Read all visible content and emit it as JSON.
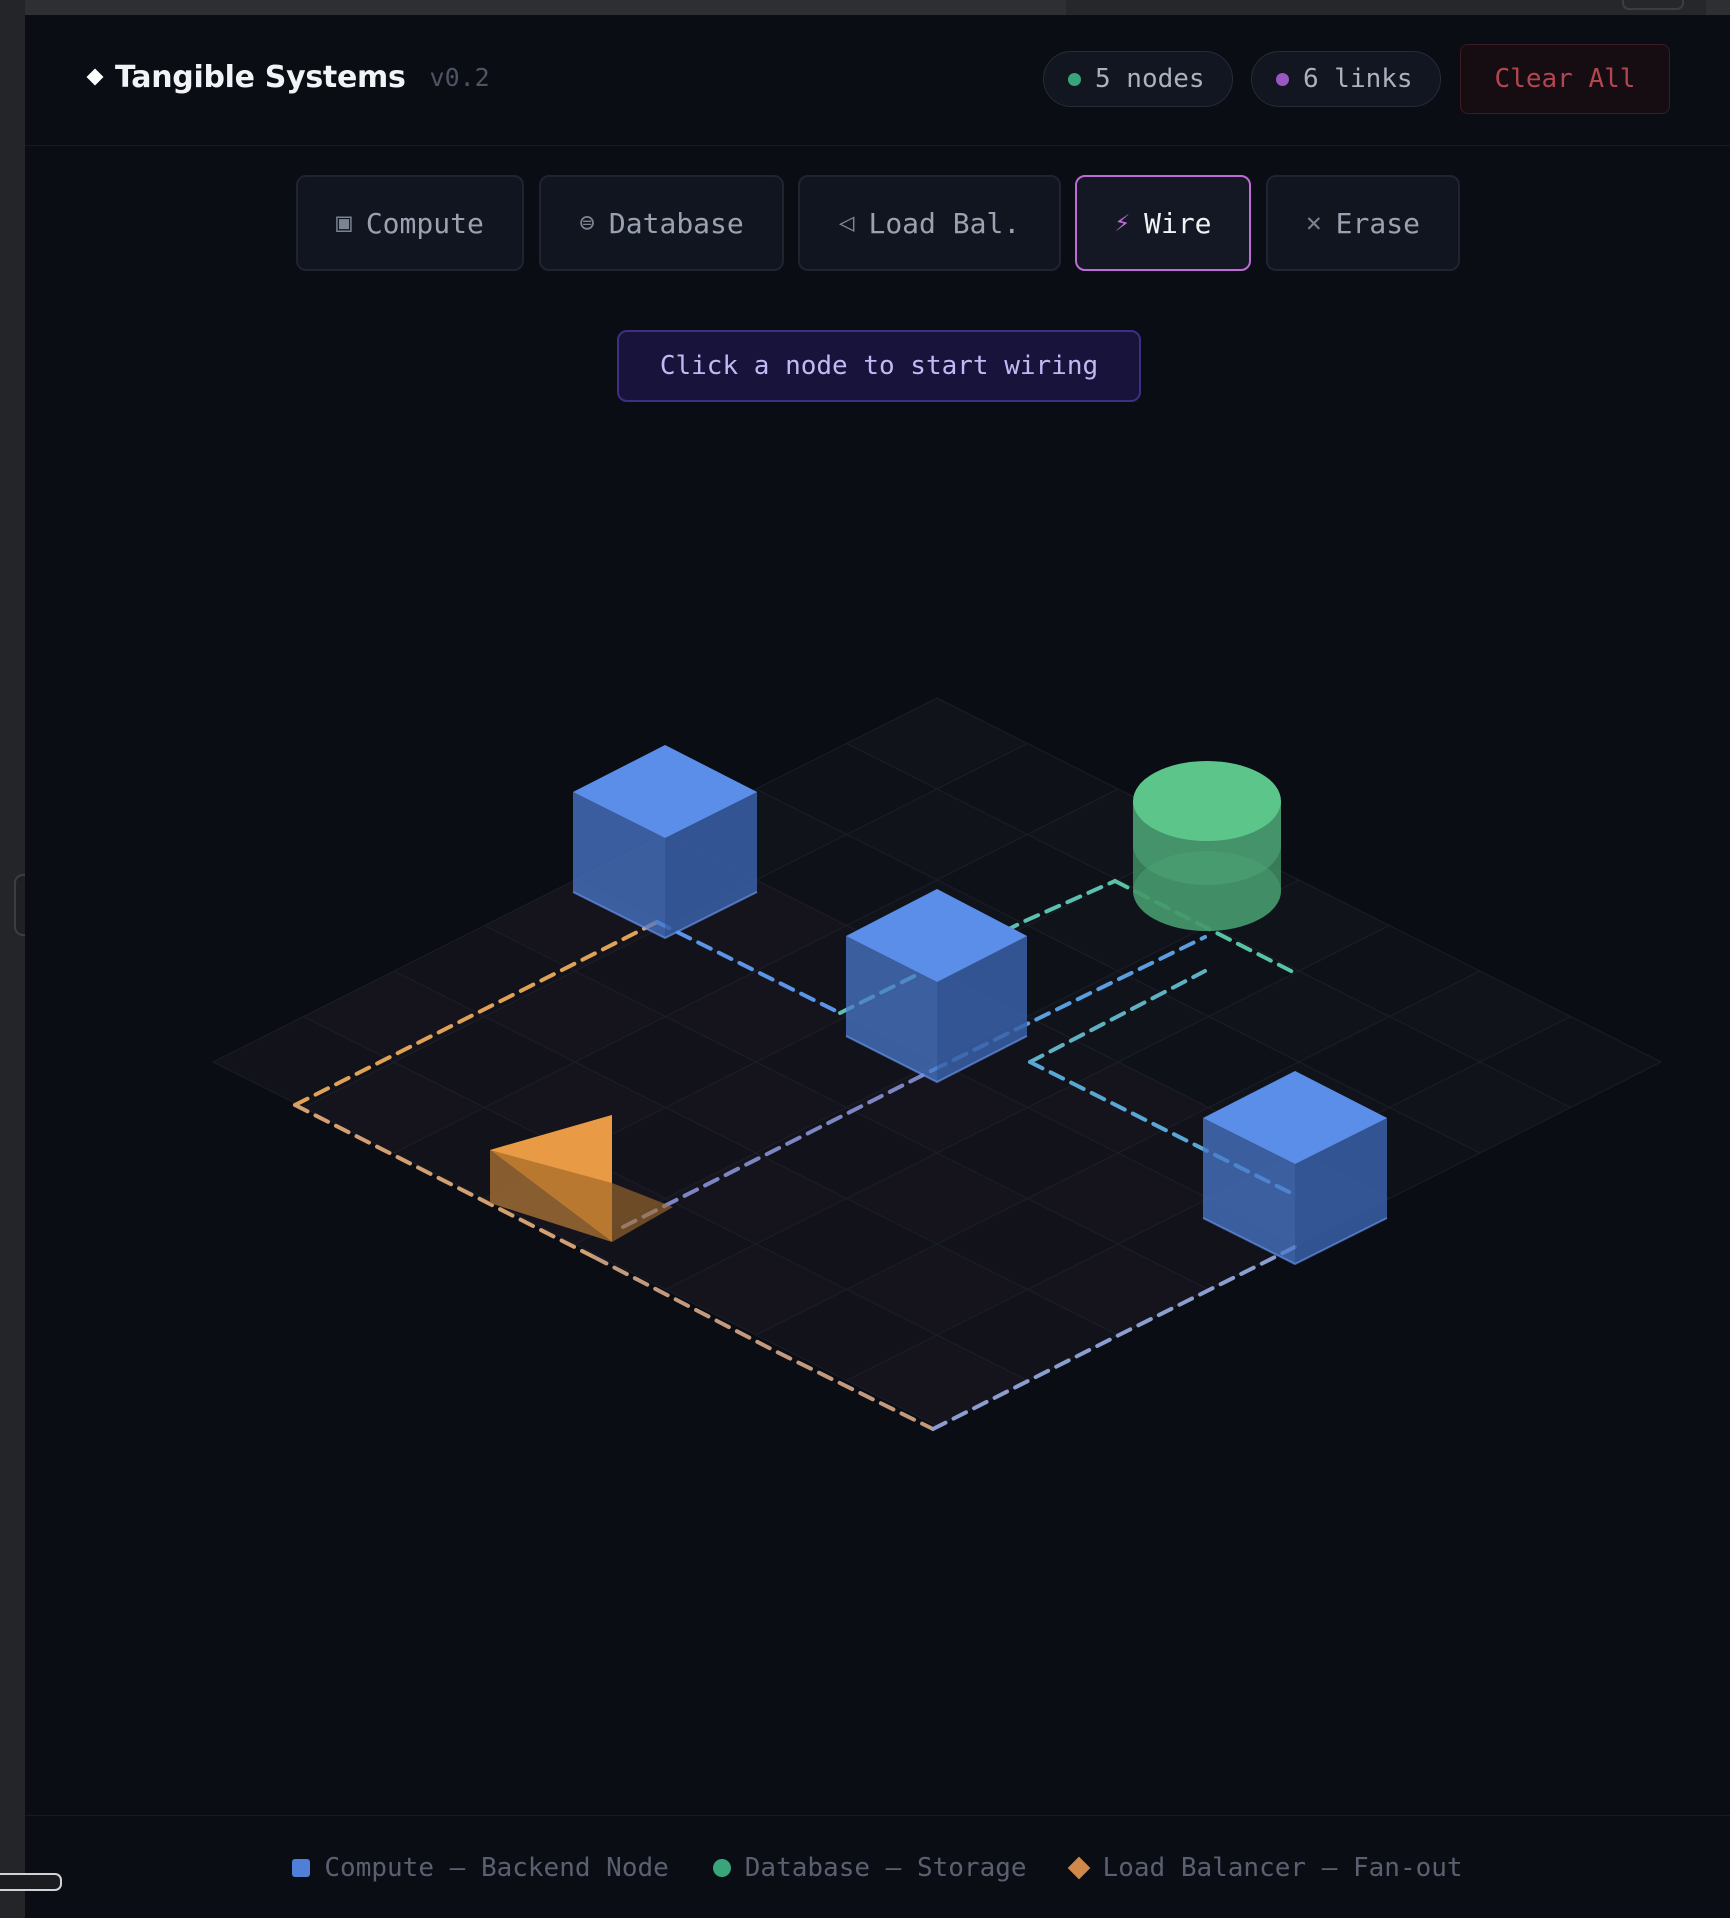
{
  "app": {
    "title": "Tangible Systems",
    "version": "v0.2"
  },
  "stats": {
    "nodes_label": "5 nodes",
    "links_label": "6 links",
    "nodes_dot_color": "#3aa57b",
    "links_dot_color": "#9a56c2"
  },
  "header": {
    "clear_label": "Clear All"
  },
  "toolbar": {
    "tools": [
      {
        "label": "Compute",
        "icon": "square-icon",
        "glyph": "▣"
      },
      {
        "label": "Database",
        "icon": "database-icon",
        "glyph": "⊜"
      },
      {
        "label": "Load Bal.",
        "icon": "triangle-icon",
        "glyph": "◁"
      },
      {
        "label": "Wire",
        "icon": "bolt-icon",
        "glyph": "⚡",
        "active": true
      },
      {
        "label": "Erase",
        "icon": "close-icon",
        "glyph": "✕"
      }
    ]
  },
  "hint": "Click a node to start wiring",
  "scene": {
    "grid": {
      "size": 8
    },
    "nodes": [
      {
        "type": "compute",
        "col": 0,
        "row": 3
      },
      {
        "type": "compute",
        "col": 2,
        "row": 3
      },
      {
        "type": "database",
        "col": 2,
        "row": 0
      },
      {
        "type": "loadbalancer",
        "col": 4,
        "row": 6
      },
      {
        "type": "compute",
        "col": 6,
        "row": 1
      }
    ],
    "links": 6
  },
  "colors": {
    "compute": "#5b8ee8",
    "database": "#5cc68a",
    "loadbalancer": "#e89a44",
    "accent": "#c06ad8"
  },
  "legend": [
    {
      "label": "Compute — Backend Node",
      "shape": "square",
      "color": "#4f7fd6"
    },
    {
      "label": "Database — Storage",
      "shape": "circle",
      "color": "#3aa57b"
    },
    {
      "label": "Load Balancer — Fan-out",
      "shape": "diamond",
      "color": "#d0894a"
    }
  ]
}
